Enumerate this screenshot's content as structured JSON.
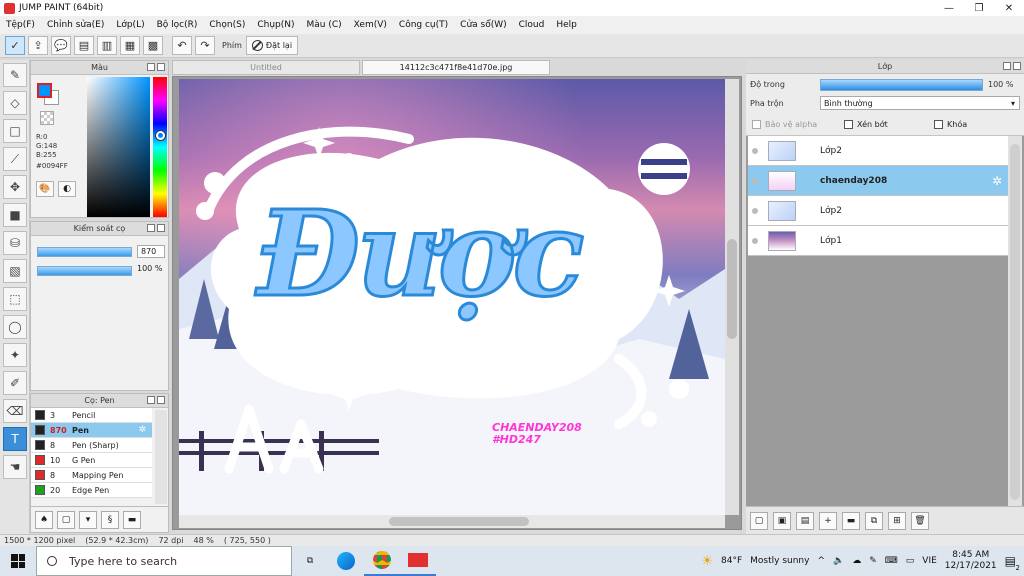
{
  "window": {
    "title": "JUMP PAINT (64bit)",
    "buttons": [
      "—",
      "❐",
      "✕"
    ]
  },
  "menu": [
    "Tệp(F)",
    "Chỉnh sửa(E)",
    "Lớp(L)",
    "Bộ lọc(R)",
    "Chọn(S)",
    "Chụp(N)",
    "Màu (C)",
    "Xem(V)",
    "Công cụ(T)",
    "Cửa sổ(W)",
    "Cloud",
    "Help"
  ],
  "toolbar": {
    "phim_label": "Phím",
    "reset_label": "Đặt lại"
  },
  "color_panel": {
    "title": "Màu",
    "r": "R:0",
    "g": "G:148",
    "b": "B:255",
    "hex": "#0094FF",
    "current_color": "#0094FF"
  },
  "brush_control": {
    "title": "Kiểm soát cọ",
    "size": "870",
    "opacity": "100 %"
  },
  "brush_list": {
    "title": "Cọ: Pen",
    "items": [
      {
        "size": "3",
        "name": "Pencil",
        "color": "#222222"
      },
      {
        "size": "870",
        "name": "Pen",
        "color": "#222222"
      },
      {
        "size": "8",
        "name": "Pen (Sharp)",
        "color": "#222222"
      },
      {
        "size": "10",
        "name": "G Pen",
        "color": "#e02a2a"
      },
      {
        "size": "8",
        "name": "Mapping Pen",
        "color": "#e02a2a"
      },
      {
        "size": "20",
        "name": "Edge Pen",
        "color": "#20a020"
      }
    ]
  },
  "tabs": [
    {
      "label": "Untitled"
    },
    {
      "label": "14112c3c471f8e41d70e.jpg"
    }
  ],
  "artwork": {
    "main_text": "Được",
    "watermark_line1": "CHAENDAY208",
    "watermark_line2": "#HD247"
  },
  "layer_panel": {
    "title": "Lớp",
    "opacity_label": "Độ trong",
    "opacity_value": "100 %",
    "blend_label": "Pha trộn",
    "blend_value": "Bình thường",
    "protect_alpha": "Bảo vệ alpha",
    "clipping": "Xén bớt",
    "lock": "Khóa",
    "layers": [
      {
        "name": "Lớp2"
      },
      {
        "name": "chaenday208"
      },
      {
        "name": "Lớp2"
      },
      {
        "name": "Lớp1"
      }
    ]
  },
  "status": {
    "size": "1500 * 1200 pixel",
    "physical": "(52.9 * 42.3cm)",
    "dpi": "72 dpi",
    "zoom": "48 %",
    "cursor": "( 725, 550 )"
  },
  "taskbar": {
    "search_placeholder": "Type here to search",
    "weather_temp": "84°F",
    "weather_text": "Mostly sunny",
    "lang": "VIE",
    "time": "8:45 AM",
    "date": "12/17/2021",
    "notifications": "2"
  }
}
